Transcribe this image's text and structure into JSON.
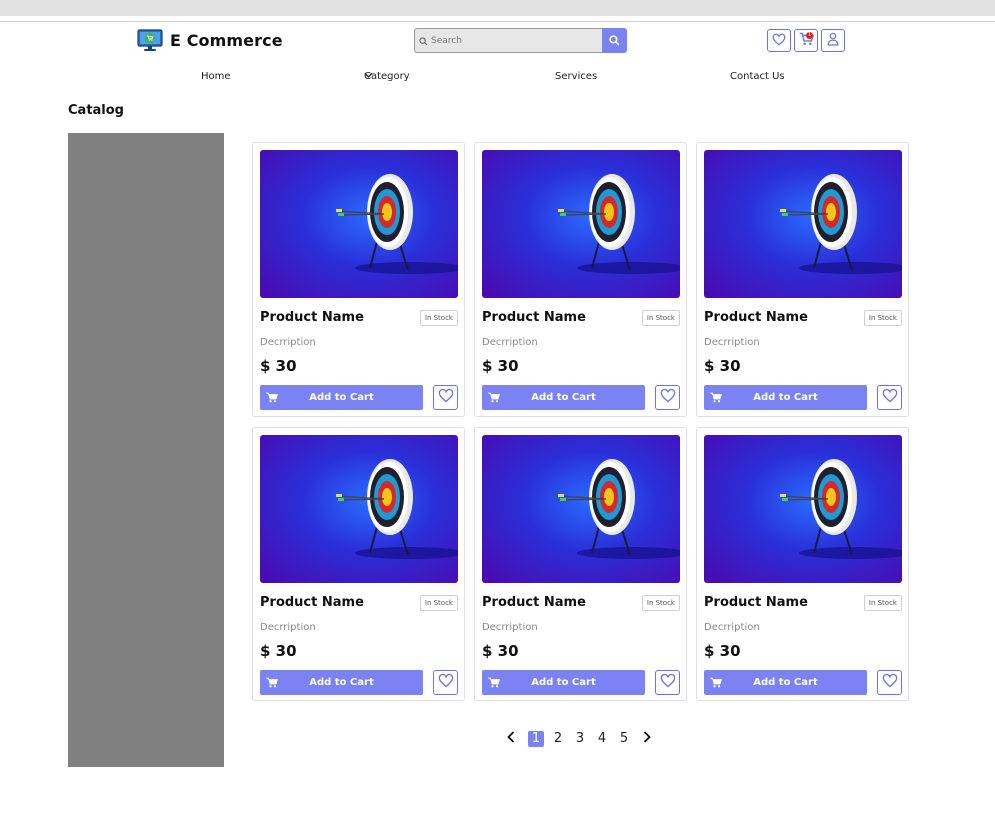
{
  "header": {
    "logo_text": "E Commerce",
    "search": {
      "placeholder": "Search"
    },
    "cart_badge": "1",
    "accent_color": "#7b83f3"
  },
  "nav": {
    "items": [
      {
        "label": "Home"
      },
      {
        "label": "Category"
      },
      {
        "label": "Services"
      },
      {
        "label": "Contact Us"
      }
    ]
  },
  "catalog": {
    "title": "Catalog",
    "products": [
      {
        "name": "Product Name",
        "stock": "In Stock",
        "description": "Decrription",
        "price": "$ 30",
        "button": "Add to Cart"
      },
      {
        "name": "Product Name",
        "stock": "In Stock",
        "description": "Decrription",
        "price": "$ 30",
        "button": "Add to Cart"
      },
      {
        "name": "Product Name",
        "stock": "In Stock",
        "description": "Decrription",
        "price": "$ 30",
        "button": "Add to Cart"
      },
      {
        "name": "Product Name",
        "stock": "In Stock",
        "description": "Decrription",
        "price": "$ 30",
        "button": "Add to Cart"
      },
      {
        "name": "Product Name",
        "stock": "In Stock",
        "description": "Decrription",
        "price": "$ 30",
        "button": "Add to Cart"
      },
      {
        "name": "Product Name",
        "stock": "In Stock",
        "description": "Decrription",
        "price": "$ 30",
        "button": "Add to Cart"
      }
    ]
  },
  "pagination": {
    "pages": [
      "1",
      "2",
      "3",
      "4",
      "5"
    ],
    "current": "1"
  }
}
